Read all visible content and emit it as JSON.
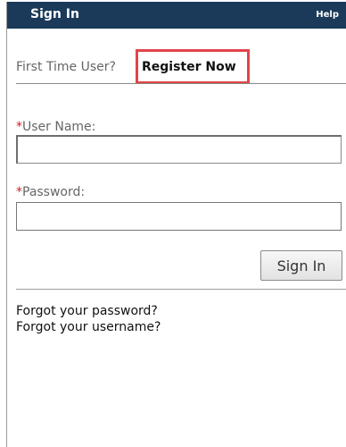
{
  "header": {
    "title": "Sign In",
    "help_label": "Help",
    "background_color": "#1b3a5a"
  },
  "registration": {
    "prompt": "First Time User?",
    "link_label": "Register Now",
    "highlight_color": "#e0454a"
  },
  "form": {
    "username_label": "User Name:",
    "username_value": "",
    "password_label": "Password:",
    "password_value": "",
    "required_marker": "*",
    "submit_label": "Sign In"
  },
  "links": {
    "forgot_password": "Forgot your password?",
    "forgot_username": "Forgot your username?"
  }
}
